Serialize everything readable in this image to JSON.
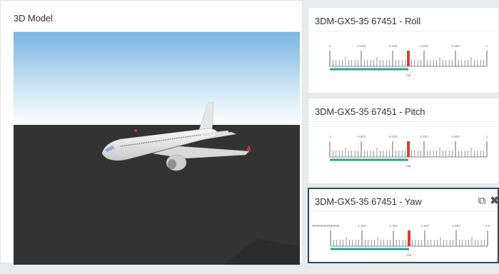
{
  "model_panel": {
    "title": "3D Model"
  },
  "gauges": [
    {
      "title": "3DM-GX5-35 67451 - Roll",
      "ticks": [
        "-1",
        "-0.600",
        "-0.200",
        "0.200",
        "0.600",
        "1"
      ],
      "unit": "rad",
      "value": 0.0,
      "min": -1,
      "max": 1,
      "bar_color": "#2aa393",
      "marker_color": "#e03a3a"
    },
    {
      "title": "3DM-GX5-35 67451 - Pitch",
      "ticks": [
        "-1",
        "-0.600",
        "-0.200",
        "0.200",
        "0.600",
        "1"
      ],
      "unit": "rad",
      "value": 0.0,
      "min": -1,
      "max": 1,
      "bar_color": "#2aa393",
      "marker_color": "#e03a3a"
    },
    {
      "title": "3DM-GX5-35 67451 - Yaw",
      "ticks": [
        "999999999999999",
        "1.300",
        "1.700",
        "2.100",
        "2.500",
        "2.9"
      ],
      "unit": "rad",
      "value": 1.9,
      "min": 0.9,
      "max": 2.9,
      "bar_color": "#2aa393",
      "marker_color": "#e03a3a",
      "icons": [
        "copy-icon",
        "close-icon"
      ]
    }
  ],
  "colors": {
    "sky_top": "#7ab6e4",
    "sky_bottom": "#ffffff",
    "ground": "#333333",
    "selected_border": "#2b4b58"
  }
}
